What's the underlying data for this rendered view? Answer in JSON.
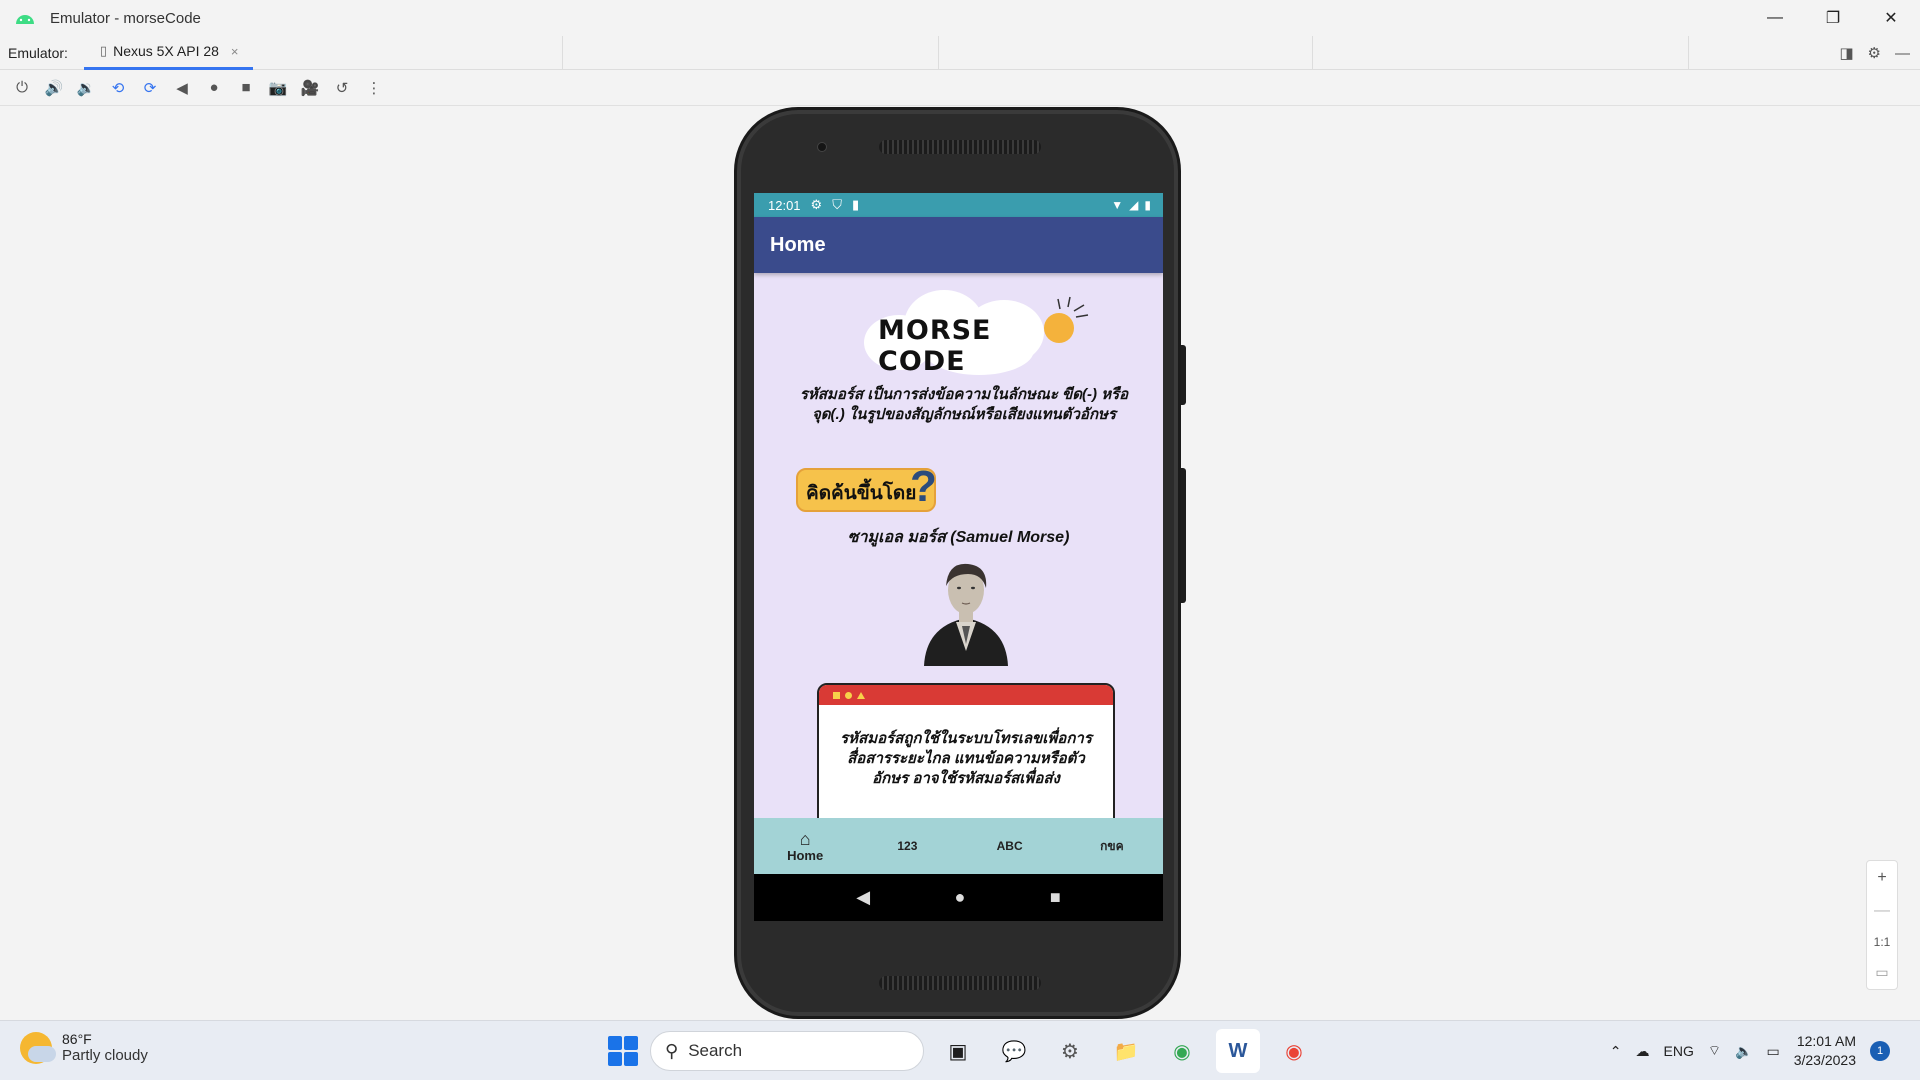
{
  "window": {
    "title": "Emulator - morseCode",
    "controls": {
      "minimize": "—",
      "restore": "❐",
      "close": "✕"
    }
  },
  "tabs": {
    "label": "Emulator:",
    "device_tab": "Nexus 5X API 28",
    "close_glyph": "×"
  },
  "toolbar": {
    "icons": [
      "power-icon",
      "volume-up-icon",
      "volume-down-icon",
      "rotate-left-icon",
      "rotate-right-icon",
      "back-icon",
      "home-icon",
      "overview-icon",
      "screenshot-icon",
      "screenrecord-icon",
      "snapshot-icon",
      "more-icon"
    ]
  },
  "phone": {
    "status_time": "12:01",
    "app_title": "Home",
    "logo_text": "MORSE CODE",
    "intro": "รหัสมอร์ส เป็นการส่งข้อความในลักษณะ ขีด(-) หรือ จุด(.) ในรูปของสัญลักษณ์หรือเสียงแทนตัวอักษร",
    "badge": "คิดค้นขึ้นโดย",
    "badge_q": "?",
    "inventor": "ซามูเอล มอร์ส (Samuel Morse)",
    "card_text": "รหัสมอร์สถูกใช้ในระบบโทรเลขเพื่อการสื่อสารระยะไกล แทนข้อความหรือตัวอักษร อาจใช้รหัสมอร์สเพื่อส่ง",
    "bottom_nav": [
      {
        "label": "Home",
        "icon": "home-icon"
      },
      {
        "label": "123"
      },
      {
        "label": "ABC"
      },
      {
        "label": "กขค"
      }
    ],
    "nav_buttons": {
      "back": "◀",
      "home": "●",
      "recents": "■"
    }
  },
  "zoom": {
    "plus": "+",
    "minus": "—",
    "one_to_one": "1:1"
  },
  "taskbar": {
    "temperature": "86°F",
    "condition": "Partly cloudy",
    "search_placeholder": "Search",
    "language": "ENG",
    "time": "12:01 AM",
    "date": "3/23/2023",
    "notification_count": "1"
  },
  "colors": {
    "status_bar": "#3a9dae",
    "app_bar": "#3a4b8c",
    "screen_bg": "#e9e1f8",
    "bottom_nav": "#a3d3d6",
    "tab_underline": "#3574f0"
  }
}
